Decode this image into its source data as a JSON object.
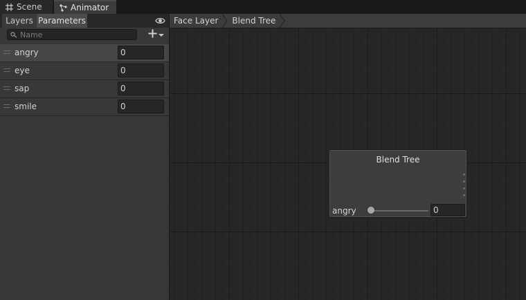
{
  "tabs": [
    {
      "label": "Scene",
      "icon": "grid-icon"
    },
    {
      "label": "Animator",
      "icon": "animator-icon"
    }
  ],
  "left_panel": {
    "tabs": [
      "Layers",
      "Parameters"
    ],
    "active_tab": "Parameters",
    "search": {
      "placeholder": "Name",
      "value": ""
    },
    "parameters": [
      {
        "name": "angry",
        "value": "0"
      },
      {
        "name": "eye",
        "value": "0"
      },
      {
        "name": "sap",
        "value": "0"
      },
      {
        "name": "smile",
        "value": "0"
      }
    ]
  },
  "breadcrumb": [
    "Face Layer",
    "Blend Tree"
  ],
  "node": {
    "title": "Blend Tree",
    "parameter": "angry",
    "value": "0",
    "slider_fraction": 0
  }
}
